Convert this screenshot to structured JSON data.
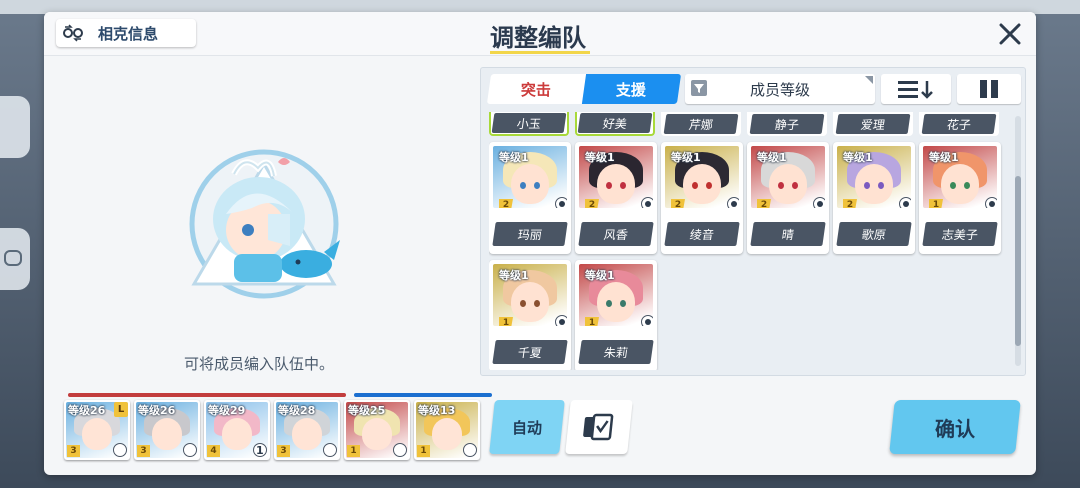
{
  "dialog": {
    "title": "调整编队",
    "club_button_label": "相克信息",
    "close_icon": "close-icon"
  },
  "placeholder": {
    "message": "可将成员编入队伍中。"
  },
  "roster": {
    "tabs": [
      {
        "label": "突击",
        "active": false,
        "color": "#cc3b3b"
      },
      {
        "label": "支援",
        "active": true,
        "color": "#1b8ff0"
      }
    ],
    "sort_label": "成员等级",
    "top_row_names": [
      {
        "name": "小玉",
        "assigned": true
      },
      {
        "name": "好美",
        "assigned": true
      },
      {
        "name": "芹娜",
        "assigned": false
      },
      {
        "name": "静子",
        "assigned": false
      },
      {
        "name": "爱理",
        "assigned": false
      },
      {
        "name": "花子",
        "assigned": false
      }
    ],
    "cards": [
      {
        "name": "玛丽",
        "level": "等级1",
        "stars": "2",
        "hair": "#f5e7b8",
        "eye": "#3d7fc0",
        "bg": "#6ab0e0"
      },
      {
        "name": "风香",
        "level": "等级1",
        "stars": "2",
        "hair": "#2b2630",
        "eye": "#c03040",
        "bg": "#c24848"
      },
      {
        "name": "绫音",
        "level": "等级1",
        "stars": "2",
        "hair": "#2c2a33",
        "eye": "#c0302f",
        "bg": "#c9b04a"
      },
      {
        "name": "晴",
        "level": "等级1",
        "stars": "2",
        "hair": "#d8d8d8",
        "eye": "#c03040",
        "bg": "#c24848"
      },
      {
        "name": "歌原",
        "level": "等级1",
        "stars": "2",
        "hair": "#b8a6e0",
        "eye": "#7a5ac0",
        "bg": "#c9b04a"
      },
      {
        "name": "志美子",
        "level": "等级1",
        "stars": "1",
        "hair": "#f0956a",
        "eye": "#3a8a5a",
        "bg": "#c24848"
      },
      {
        "name": "千夏",
        "level": "等级1",
        "stars": "1",
        "hair": "#f0c8a0",
        "eye": "#8a5030",
        "bg": "#c9b04a"
      },
      {
        "name": "朱莉",
        "level": "等级1",
        "stars": "1",
        "hair": "#e88a9a",
        "eye": "#3a7a6a",
        "bg": "#c24848"
      }
    ]
  },
  "team": {
    "strikers": [
      {
        "level": "等级26",
        "stars": "3",
        "leader": "L",
        "hair": "#d8d8dc",
        "bg": "#6ab0e0"
      },
      {
        "level": "等级26",
        "stars": "3",
        "hair": "#c8c8cc",
        "bg": "#6ab0e0"
      },
      {
        "level": "等级29",
        "stars": "4",
        "count": "1",
        "hair": "#f2b8c8",
        "bg": "#8ac0ea"
      },
      {
        "level": "等级28",
        "stars": "3",
        "hair": "#d0d4d8",
        "bg": "#6ab0e0"
      }
    ],
    "specials": [
      {
        "level": "等级25",
        "stars": "1",
        "hair": "#f0e4b0",
        "bg": "#c24848"
      },
      {
        "level": "等级13",
        "stars": "1",
        "hair": "#f2c65a",
        "bg": "#c9b04a"
      }
    ],
    "auto_label": "自动",
    "confirm_label": "确认"
  },
  "colors": {
    "striker_line": "#c23d3d",
    "special_line": "#1b6fd0",
    "confirm": "#62c7ef",
    "accent_title_underline": "#f2d64a"
  }
}
